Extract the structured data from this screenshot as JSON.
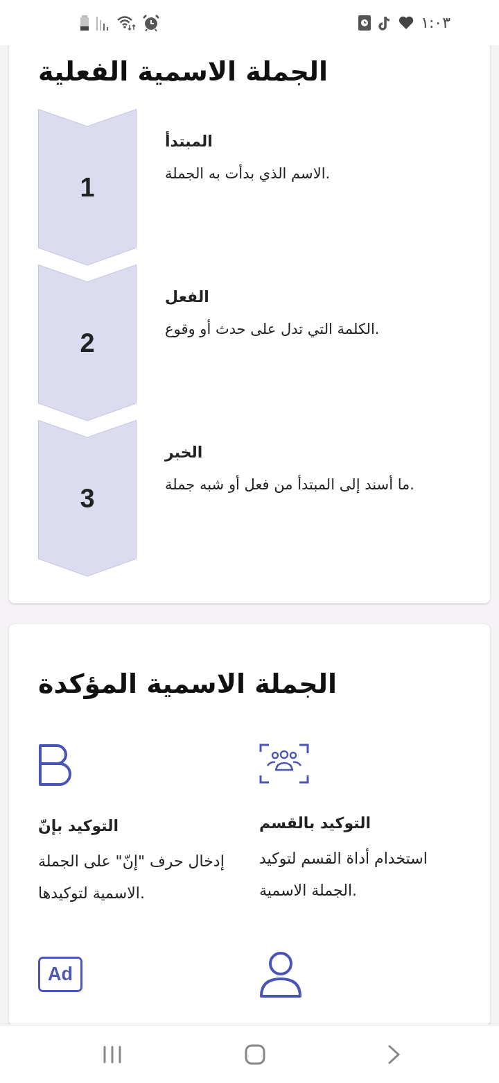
{
  "status_bar": {
    "time": "١:٠٣"
  },
  "steps_card": {
    "title": "الجملة الاسمية الفعلية",
    "steps": [
      {
        "number": "1",
        "title": "المبتدأ",
        "description": "الاسم الذي بدأت به الجملة."
      },
      {
        "number": "2",
        "title": "الفعل",
        "description": "الكلمة التي تدل على حدث أو وقوع."
      },
      {
        "number": "3",
        "title": "الخبر",
        "description": "ما أسند إلى المبتدأ من فعل أو شبه جملة."
      }
    ]
  },
  "features_card": {
    "title": "الجملة الاسمية المؤكدة",
    "items": [
      {
        "kind": "group-frame",
        "title": "التوكيد بالقسم",
        "description": "استخدام أداة القسم لتوكيد الجملة الاسمية."
      },
      {
        "kind": "bold-letter",
        "title": "التوكيد بإنّ",
        "description": "إدخال حرف \"إنّ\" على الجملة الاسمية لتوكيدها."
      },
      {
        "kind": "person"
      },
      {
        "kind": "ad-badge",
        "icon_text": "Ad"
      }
    ]
  }
}
